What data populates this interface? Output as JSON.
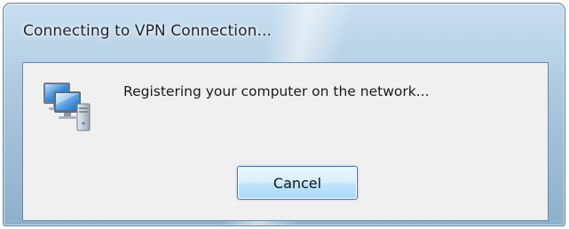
{
  "window": {
    "title": "Connecting to VPN Connection..."
  },
  "dialog": {
    "icon": "network-computer-icon",
    "message": "Registering your computer on the network...",
    "cancel_label": "Cancel"
  },
  "colors": {
    "frame_glass": "#a9c6dd",
    "client_background": "#f0f0f0",
    "button_border": "#3c7fb1",
    "button_face": "#d9f0fc"
  }
}
